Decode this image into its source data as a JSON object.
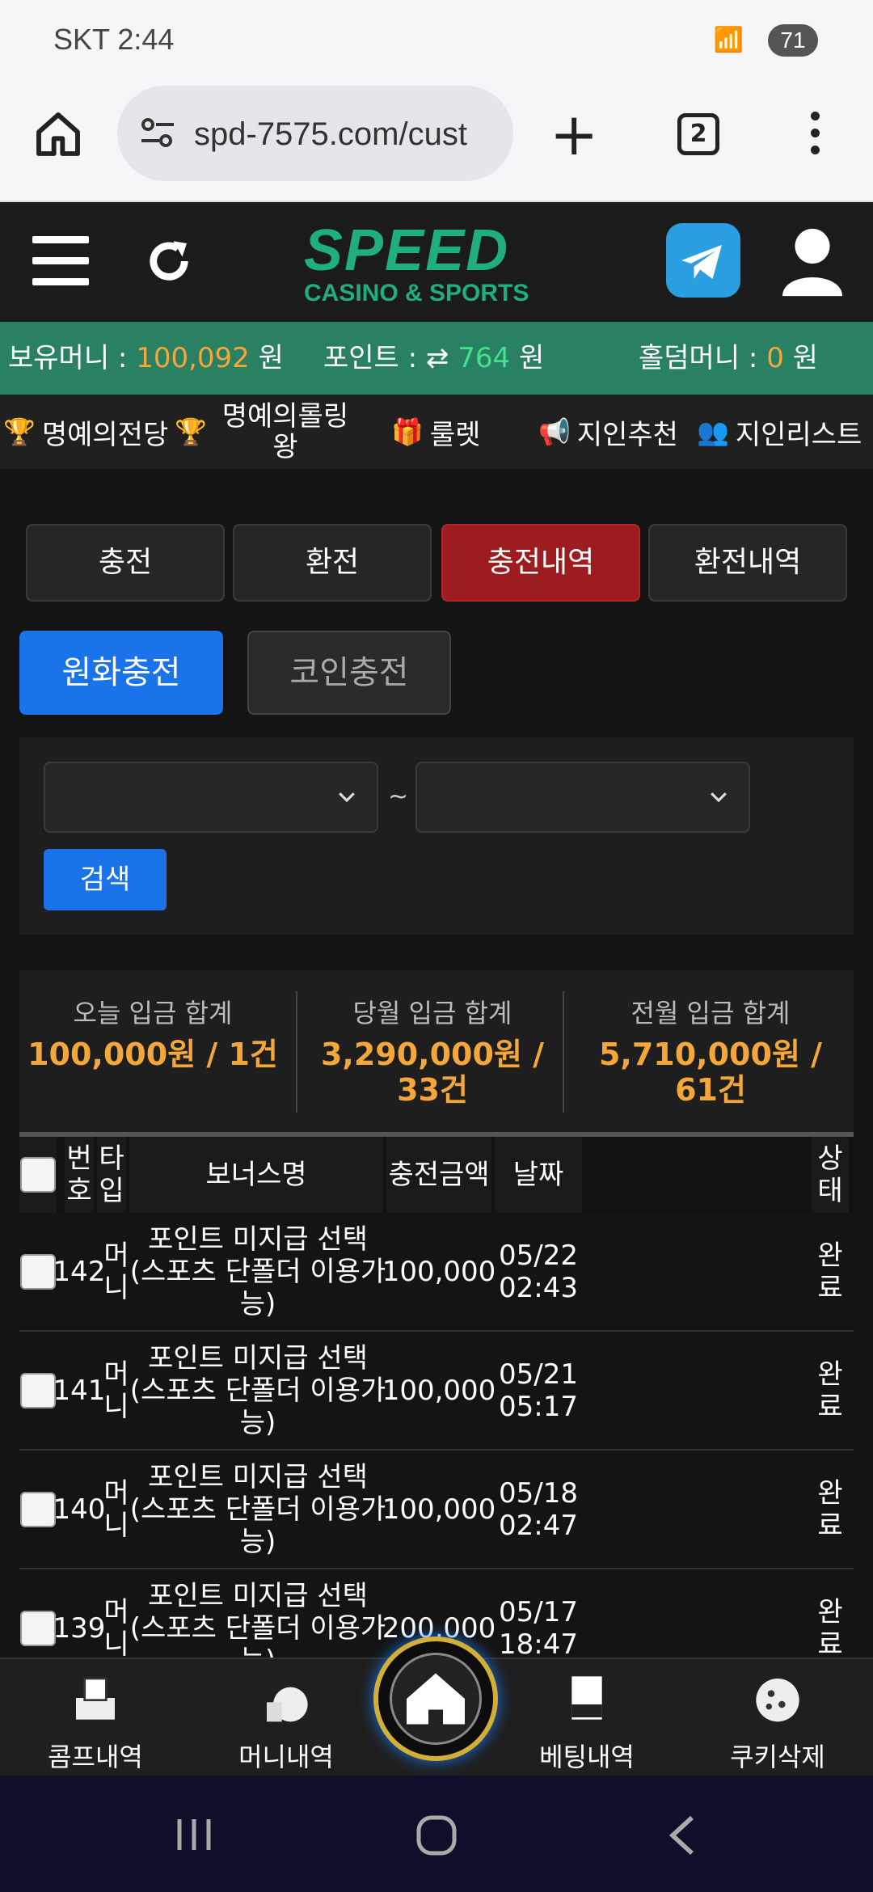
{
  "status": {
    "carrier_time": "SKT 2:44",
    "battery": "71"
  },
  "browser": {
    "url": "spd-7575.com/cust",
    "tab_count": "2"
  },
  "header": {
    "logo_main": "SPEED",
    "logo_sub": "CASINO & SPORTS"
  },
  "balance": {
    "money_label": "보유머니 :",
    "money_value": "100,092",
    "money_unit": "원",
    "point_label": "포인트 :",
    "point_value": "764",
    "point_unit": "원",
    "holdem_label": "홀덤머니 :",
    "holdem_value": "0",
    "holdem_unit": "원"
  },
  "menu": {
    "items": [
      {
        "label": "명예의전당",
        "icon": "trophy-icon"
      },
      {
        "label": "명예의롤링왕",
        "icon": "trophy-icon"
      },
      {
        "label": "룰렛",
        "icon": "gift-icon"
      },
      {
        "label": "지인추천",
        "icon": "megaphone-icon"
      },
      {
        "label": "지인리스트",
        "icon": "users-icon"
      }
    ]
  },
  "tabs": [
    "충전",
    "환전",
    "충전내역",
    "환전내역"
  ],
  "subtabs": {
    "krw": "원화충전",
    "coin": "코인충전"
  },
  "filter": {
    "search_label": "검색",
    "separator": "~"
  },
  "summary": [
    {
      "label": "오늘 입금 합계",
      "value": "100,000원 / 1건"
    },
    {
      "label": "당월 입금 합계",
      "value": "3,290,000원 / 33건"
    },
    {
      "label": "전월 입금 합계",
      "value": "5,710,000원 / 61건"
    }
  ],
  "table": {
    "headers": {
      "no": "번호",
      "type": "타입",
      "bonus": "보너스명",
      "amount": "충전금액",
      "date": "날짜",
      "status": "상태"
    },
    "rows": [
      {
        "no": "142",
        "type": "머니",
        "bonus": "포인트 미지급 선택 (스포츠 단폴더 이용가능)",
        "amount": "100,000",
        "date": "05/22 02:43",
        "status": "완료"
      },
      {
        "no": "141",
        "type": "머니",
        "bonus": "포인트 미지급 선택 (스포츠 단폴더 이용가능)",
        "amount": "100,000",
        "date": "05/21 05:17",
        "status": "완료"
      },
      {
        "no": "140",
        "type": "머니",
        "bonus": "포인트 미지급 선택 (스포츠 단폴더 이용가능)",
        "amount": "100,000",
        "date": "05/18 02:47",
        "status": "완료"
      },
      {
        "no": "139",
        "type": "머니",
        "bonus": "포인트 미지급 선택 (스포츠 단폴더 이용가능)",
        "amount": "200,000",
        "date": "05/17 18:47",
        "status": "완료"
      }
    ]
  },
  "bottomnav": {
    "comp": "콤프내역",
    "money": "머니내역",
    "bet": "베팅내역",
    "cookie": "쿠키삭제"
  },
  "colors": {
    "accent_green": "#2a8063",
    "active_tab": "#9c1c1f",
    "primary_blue": "#1a73e8",
    "amount_gold": "#f3a73a"
  }
}
